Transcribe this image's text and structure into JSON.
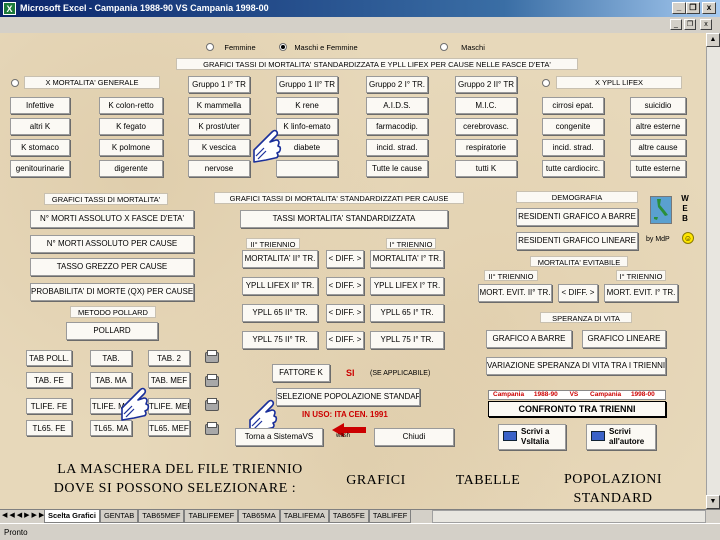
{
  "window": {
    "title": "Microsoft Excel - Campania 1988-90 VS Campania 1998-00",
    "app_icon": "excel-icon",
    "minimize": "_",
    "restore": "❐",
    "close": "x"
  },
  "top": {
    "radio_femmine": "Femmine",
    "radio_maschi_femmine": "Maschi e Femmine",
    "radio_maschi": "Maschi",
    "selected": "Maschi e Femmine",
    "section_title": "GRAFICI TASSI DI MORTALITA' STANDARDIZZATA E YPLL LIFEX PER CAUSE NELLE FASCE D'ETA'"
  },
  "causes": {
    "radio_mortalita": "X MORTALITA' GENERALE",
    "radio_ypll": "X YPLL LIFEX",
    "groups": [
      "Gruppo 1 I° TR",
      "Gruppo 1 II° TR",
      "Gruppo 2 I° TR.",
      "Gruppo 2 II° TR"
    ],
    "rows": [
      [
        "Infettive",
        "K colon-retto",
        "K mammella",
        "K rene",
        "A.I.D.S.",
        "M.I.C.",
        "cirrosi epat.",
        "suicidio"
      ],
      [
        "altri K",
        "K fegato",
        "K prost/uter",
        "K linfo-emato",
        "farmacodip.",
        "cerebrovasc.",
        "congenite",
        "altre esterne"
      ],
      [
        "K stomaco",
        "K polmone",
        "K vescica",
        "diabete",
        "incid. strad.",
        "respiratorie",
        "incid. strad.",
        "altre cause"
      ],
      [
        "genitourinarie",
        "digerente",
        "nervose",
        "",
        "Tutte le cause",
        "tutti K",
        "tutte cardiocirc.",
        "tutte esterne"
      ]
    ]
  },
  "mortalita": {
    "title": "GRAFICI TASSI DI MORTALITA'",
    "buttons": [
      "N° MORTI ASSOLUTO X FASCE D'ETA'",
      "N° MORTI ASSOLUTO PER CAUSE",
      "TASSO GREZZO PER CAUSE",
      "PROBABILITA' DI MORTE (QX) PER CAUSE"
    ]
  },
  "pollard": {
    "title": "METODO POLLARD",
    "button": "POLLARD"
  },
  "tables": {
    "rows": [
      [
        "TAB POLL.",
        "TAB.",
        "TAB. 2"
      ],
      [
        "TAB. FE",
        "TAB. MA",
        "TAB. MEF"
      ],
      [
        "TLIFE. FE",
        "TLIFE. MA",
        "TLIFE. MEF"
      ],
      [
        "TL65. FE",
        "TL65. MA",
        "TL65. MEF"
      ]
    ]
  },
  "standard": {
    "title": "GRAFICI TASSI DI MORTALITA' STANDARDIZZATI PER CAUSE",
    "button_tassi": "TASSI MORTALITA' STANDARDIZZATA",
    "ii_triennio": "II° TRIENNIO",
    "i_triennio": "I° TRIENNIO",
    "rows": [
      [
        "MORTALITA' II° TR.",
        "< DIFF. >",
        "MORTALITA' I° TR."
      ],
      [
        "YPLL LIFEX II° TR.",
        "< DIFF. >",
        "YPLL LIFEX I° TR."
      ],
      [
        "YPLL 65 II° TR.",
        "< DIFF. >",
        "YPLL 65 I° TR."
      ],
      [
        "YPLL 75 II° TR.",
        "< DIFF. >",
        "YPLL 75 I° TR."
      ]
    ]
  },
  "fattore": {
    "button": "FATTORE K",
    "si": "SI",
    "applicabile": "(SE APPLICABILE)",
    "selezione": "SELEZIONE POPOLAZIONE STANDARD",
    "in_uso": "IN USO:  ITA CEN. 1991"
  },
  "bottom": {
    "torna": "Torna a SistemaVS",
    "wash": "wash",
    "chiudi": "Chiudi"
  },
  "demografia": {
    "title": "DEMOGRAFIA",
    "abarre": "RESIDENTI GRAFICO A BARRE",
    "lineare": "RESIDENTI GRAFICO LINEARE",
    "web": "W E B",
    "by": "by MdP"
  },
  "evitabile": {
    "title": "MORTALITA' EVITABILE",
    "ii": "II° TRIENNIO",
    "i": "I° TRIENNIO",
    "btn_ii": "MORT. EVIT. II° TR.",
    "diff": "< DIFF. >",
    "btn_i": "MORT. EVIT. I° TR."
  },
  "speranza": {
    "title": "SPERANZA DI VITA",
    "abarre": "GRAFICO A BARRE",
    "lineare": "GRAFICO LINEARE",
    "variazione": "VARIAZIONE SPERANZA DI VITA TRA I TRIENNI"
  },
  "confronto": {
    "left_name": "Campania",
    "left_years": "1988-90",
    "vs": "VS",
    "right_name": "Campania",
    "right_years": "1998-00",
    "button": "CONFRONTO  TRA  TRIENNI"
  },
  "scrivi": {
    "vsitalia": "Scrivi a VsItalia",
    "autore": "Scrivi all'autore"
  },
  "caption": {
    "line1": "LA MASCHERA DEL FILE TRIENNIO",
    "line2": "DOVE SI POSSONO SELEZIONARE :",
    "grafici": "GRAFICI",
    "tabelle": "TABELLE",
    "popolazioni": "POPOLAZIONI",
    "standard": "STANDARD"
  },
  "tabs": [
    "Scelta Grafici",
    "GENTAB",
    "TAB65MEF",
    "TABLIFEMEF",
    "TAB65MA",
    "TABLIFEMA",
    "TAB65FE",
    "TABLIFEF"
  ],
  "status": "Pronto",
  "colors": {
    "accent_red": "#cc0000",
    "paper": "#e7d8ba",
    "hand": "#1a2f9a"
  }
}
